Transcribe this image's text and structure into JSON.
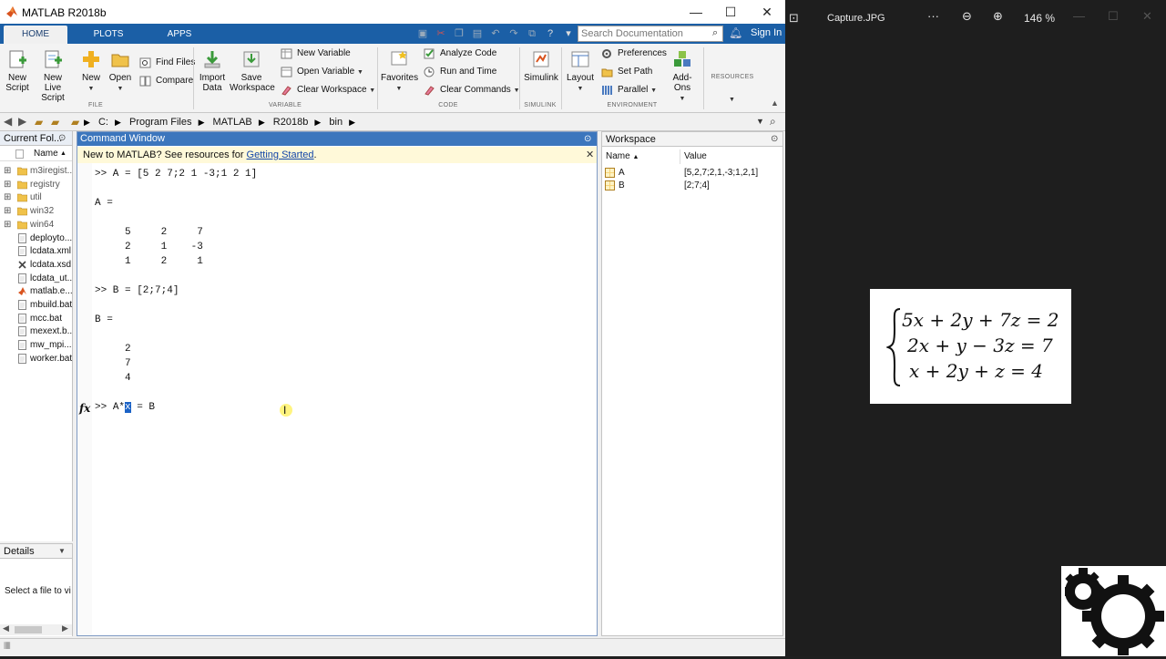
{
  "window": {
    "title": "MATLAB R2018b",
    "minimize": "—",
    "maximize": "☐",
    "close": "✕"
  },
  "tabs": [
    {
      "label": "HOME"
    },
    {
      "label": "PLOTS"
    },
    {
      "label": "APPS"
    }
  ],
  "search": {
    "placeholder": "Search Documentation"
  },
  "sign_in": "Sign In",
  "ribbon": {
    "file": {
      "new_script": [
        "New",
        "Script"
      ],
      "new_live_script": [
        "New",
        "Live Script"
      ],
      "new": "New",
      "open": "Open",
      "find_files": "Find Files",
      "compare": "Compare",
      "group": "FILE"
    },
    "variable": {
      "import_data": [
        "Import",
        "Data"
      ],
      "save_workspace": [
        "Save",
        "Workspace"
      ],
      "new_variable": "New Variable",
      "open_variable": "Open Variable",
      "clear_workspace": "Clear Workspace",
      "group": "VARIABLE"
    },
    "code": {
      "favorites": "Favorites",
      "analyze_code": "Analyze Code",
      "run_and_time": "Run and Time",
      "clear_commands": "Clear Commands",
      "group": "CODE"
    },
    "simulink": {
      "simulink": "Simulink",
      "group": "SIMULINK"
    },
    "environment": {
      "layout": "Layout",
      "preferences": "Preferences",
      "set_path": "Set Path",
      "parallel": "Parallel",
      "add_ons": "Add-Ons",
      "group": "ENVIRONMENT"
    },
    "resources": {
      "group": "RESOURCES"
    }
  },
  "address": {
    "crumbs": [
      "C:",
      "Program Files",
      "MATLAB",
      "R2018b",
      "bin"
    ]
  },
  "current_folder": {
    "title": "Current Fol...",
    "name_header": "Name",
    "items": [
      {
        "name": "m3iregist...",
        "type": "folder"
      },
      {
        "name": "registry",
        "type": "folder"
      },
      {
        "name": "util",
        "type": "folder"
      },
      {
        "name": "win32",
        "type": "folder"
      },
      {
        "name": "win64",
        "type": "folder"
      },
      {
        "name": "deployto...",
        "type": "file"
      },
      {
        "name": "lcdata.xml",
        "type": "file"
      },
      {
        "name": "lcdata.xsd",
        "type": "xsd"
      },
      {
        "name": "lcdata_ut...",
        "type": "file"
      },
      {
        "name": "matlab.e...",
        "type": "matlab"
      },
      {
        "name": "mbuild.bat",
        "type": "file"
      },
      {
        "name": "mcc.bat",
        "type": "file"
      },
      {
        "name": "mexext.b...",
        "type": "file"
      },
      {
        "name": "mw_mpi...",
        "type": "file"
      },
      {
        "name": "worker.bat",
        "type": "file"
      }
    ]
  },
  "details": {
    "title": "Details",
    "message": "Select a file to vi"
  },
  "command_window": {
    "title": "Command Window",
    "banner_text": "New to MATLAB? See resources for ",
    "banner_link": "Getting Started",
    "banner_end": ".",
    "lines": [
      ">> A = [5 2 7;2 1 -3;1 2 1]",
      "A =",
      "     5     2     7",
      "     2     1    -3",
      "     1     2     1",
      ">> B = [2;7;4]",
      "B =",
      "     2",
      "     7",
      "     4"
    ],
    "prompt": ">> ",
    "input_before": "A*",
    "input_selected": "x",
    "input_after": " = B",
    "fx": "fx"
  },
  "workspace": {
    "title": "Workspace",
    "name_header": "Name",
    "value_header": "Value",
    "vars": [
      {
        "name": "A",
        "value": "[5,2,7;2,1,-3;1,2,1]"
      },
      {
        "name": "B",
        "value": "[2;7;4]"
      }
    ]
  },
  "viewer": {
    "title": "Capture.JPG",
    "more": "···",
    "zoom": "146 %",
    "equation": [
      "5x + 2y + 7z = 2",
      "2x + y − 3z = 7",
      "x + 2y + z = 4"
    ]
  }
}
